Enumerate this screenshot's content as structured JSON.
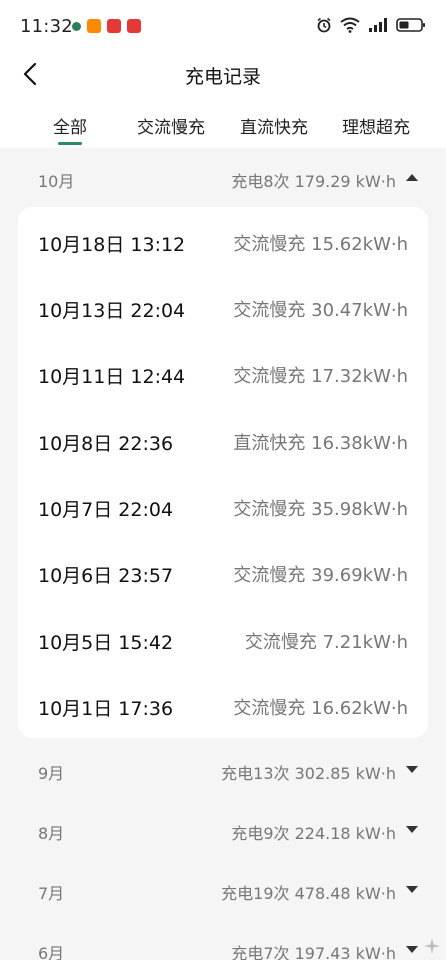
{
  "status_bar": {
    "time": "11:32",
    "app_colors": [
      "#2e7d5b",
      "#ff8a00",
      "#e53935",
      "#e53935"
    ]
  },
  "header": {
    "title": "充电记录"
  },
  "tabs": [
    {
      "label": "全部",
      "active": true
    },
    {
      "label": "交流慢充",
      "active": false
    },
    {
      "label": "直流快充",
      "active": false
    },
    {
      "label": "理想超充",
      "active": false
    }
  ],
  "expanded_month": {
    "label": "10月",
    "summary": "充电8次 179.29 kW·h",
    "expanded": true,
    "records": [
      {
        "date": "10月18日 13:12",
        "detail": "交流慢充 15.62kW·h"
      },
      {
        "date": "10月13日 22:04",
        "detail": "交流慢充 30.47kW·h"
      },
      {
        "date": "10月11日 12:44",
        "detail": "交流慢充 17.32kW·h"
      },
      {
        "date": "10月8日 22:36",
        "detail": "直流快充 16.38kW·h"
      },
      {
        "date": "10月7日 22:04",
        "detail": "交流慢充 35.98kW·h"
      },
      {
        "date": "10月6日 23:57",
        "detail": "交流慢充 39.69kW·h"
      },
      {
        "date": "10月5日 15:42",
        "detail": "交流慢充 7.21kW·h"
      },
      {
        "date": "10月1日 17:36",
        "detail": "交流慢充 16.62kW·h"
      }
    ]
  },
  "collapsed_months": [
    {
      "label": "9月",
      "summary": "充电13次 302.85 kW·h",
      "expanded": false
    },
    {
      "label": "8月",
      "summary": "充电9次 224.18 kW·h",
      "expanded": false
    },
    {
      "label": "7月",
      "summary": "充电19次 478.48 kW·h",
      "expanded": false
    },
    {
      "label": "6月",
      "summary": "充电7次 197.43 kW·h",
      "expanded": false
    }
  ],
  "accent_color": "#2c8a63"
}
